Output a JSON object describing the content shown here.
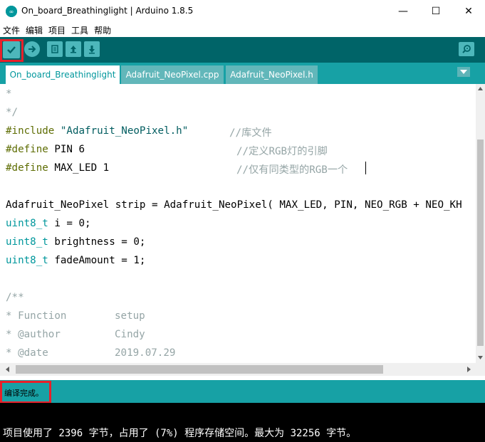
{
  "window": {
    "title": "On_board_Breathinglight | Arduino 1.8.5",
    "minimize": "—",
    "maximize": "☐",
    "close": "✕"
  },
  "menu": [
    "文件",
    "编辑",
    "项目",
    "工具",
    "帮助"
  ],
  "toolbar": {
    "icons": [
      "verify-icon",
      "upload-icon",
      "new-icon",
      "open-icon",
      "save-icon",
      "serial-monitor-icon"
    ]
  },
  "tabs": [
    {
      "label": "On_board_Breathinglight",
      "active": true
    },
    {
      "label": "Adafruit_NeoPixel.cpp",
      "active": false
    },
    {
      "label": "Adafruit_NeoPixel.h",
      "active": false
    }
  ],
  "editor": {
    "lines": {
      "l1": "*",
      "l2": "*/",
      "l3a": "#include",
      "l3b": "\"Adafruit_NeoPixel.h\"",
      "l3c": "//库文件",
      "l4a": "#define",
      "l4b": " PIN 6",
      "l4c": "//定义RGB灯的引脚",
      "l5a": "#define",
      "l5b": " MAX_LED 1",
      "l5c": "//仅有同类型的RGB一个",
      "l7": "Adafruit_NeoPixel strip = Adafruit_NeoPixel( MAX_LED, PIN, NEO_RGB + NEO_KH",
      "l8a": "uint8_t",
      "l8b": " i = 0;",
      "l9a": "uint8_t",
      "l9b": " brightness = 0;",
      "l10a": "uint8_t",
      "l10b": " fadeAmount = 1;",
      "l12": "/**",
      "l13a": "* Function",
      "l13b": "setup",
      "l14a": "* @author",
      "l14b": "Cindy",
      "l15a": "* @date",
      "l15b": "2019.07.29"
    }
  },
  "status": {
    "message": "编译完成。"
  },
  "console": {
    "output": "项目使用了 2396 字节，占用了 (7%) 程序存储空间。最大为 32256 字节。"
  },
  "colors": {
    "toolbar": "#006468",
    "tabbar": "#17a1a5",
    "accent": "#00979c",
    "highlight": "#e8202a"
  }
}
